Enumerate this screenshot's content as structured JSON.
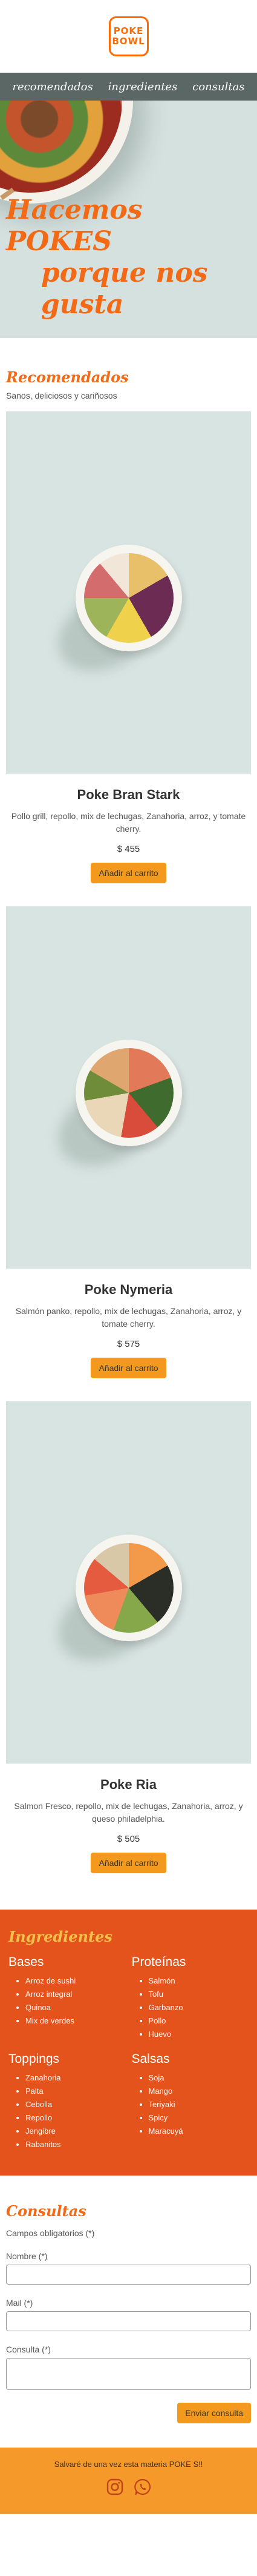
{
  "logo": {
    "line1": "POKE",
    "line2": "BOWL"
  },
  "nav": {
    "items": [
      "recomendados",
      "ingredientes",
      "consultas"
    ]
  },
  "hero": {
    "title_line1": "Hacemos POKES",
    "title_line2": "porque nos gusta"
  },
  "recommended": {
    "title": "Recomendados",
    "subtitle": "Sanos, deliciosos y cariñosos",
    "products": [
      {
        "name": "Poke Bran Stark",
        "description": "Pollo grill, repollo, mix de lechugas, Zanahoria, arroz, y tomate cherry.",
        "price": "$ 455",
        "button": "Añadir al carrito"
      },
      {
        "name": "Poke Nymeria",
        "description": "Salmón panko, repollo, mix de lechugas, Zanahoria, arroz, y tomate cherry.",
        "price": "$ 575",
        "button": "Añadir al carrito"
      },
      {
        "name": "Poke Ria",
        "description": "Salmon Fresco, repollo, mix de lechugas, Zanahoria, arroz, y queso philadelphia.",
        "price": "$ 505",
        "button": "Añadir al carrito"
      }
    ]
  },
  "ingredients": {
    "title": "Ingredientes",
    "groups": [
      {
        "name": "Bases",
        "items": [
          "Arroz de sushi",
          "Arroz integral",
          "Quinoa",
          "Mix de verdes"
        ]
      },
      {
        "name": "Proteínas",
        "items": [
          "Salmón",
          "Tofu",
          "Garbanzo",
          "Pollo",
          "Huevo"
        ]
      },
      {
        "name": "Toppings",
        "items": [
          "Zanahoria",
          "Palta",
          "Cebolla",
          "Repollo",
          "Jengibre",
          "Rabanitos"
        ]
      },
      {
        "name": "Salsas",
        "items": [
          "Soja",
          "Mango",
          "Teriyaki",
          "Spicy",
          "Maracuyá"
        ]
      }
    ]
  },
  "contact": {
    "title": "Consultas",
    "required_note": "Campos obligatorios (*)",
    "name_label": "Nombre (*)",
    "mail_label": "Mail (*)",
    "query_label": "Consulta (*)",
    "submit": "Enviar consulta"
  },
  "footer": {
    "text": "Salvaré de una vez esta materia POKE S!!"
  },
  "icons": [
    "instagram-icon",
    "whatsapp-icon"
  ],
  "colors": {
    "accent": "#f26a16",
    "nav": "#5b6765",
    "ingredients_bg": "#e3531b",
    "button": "#f39a1e",
    "footer": "#f59a2a"
  }
}
